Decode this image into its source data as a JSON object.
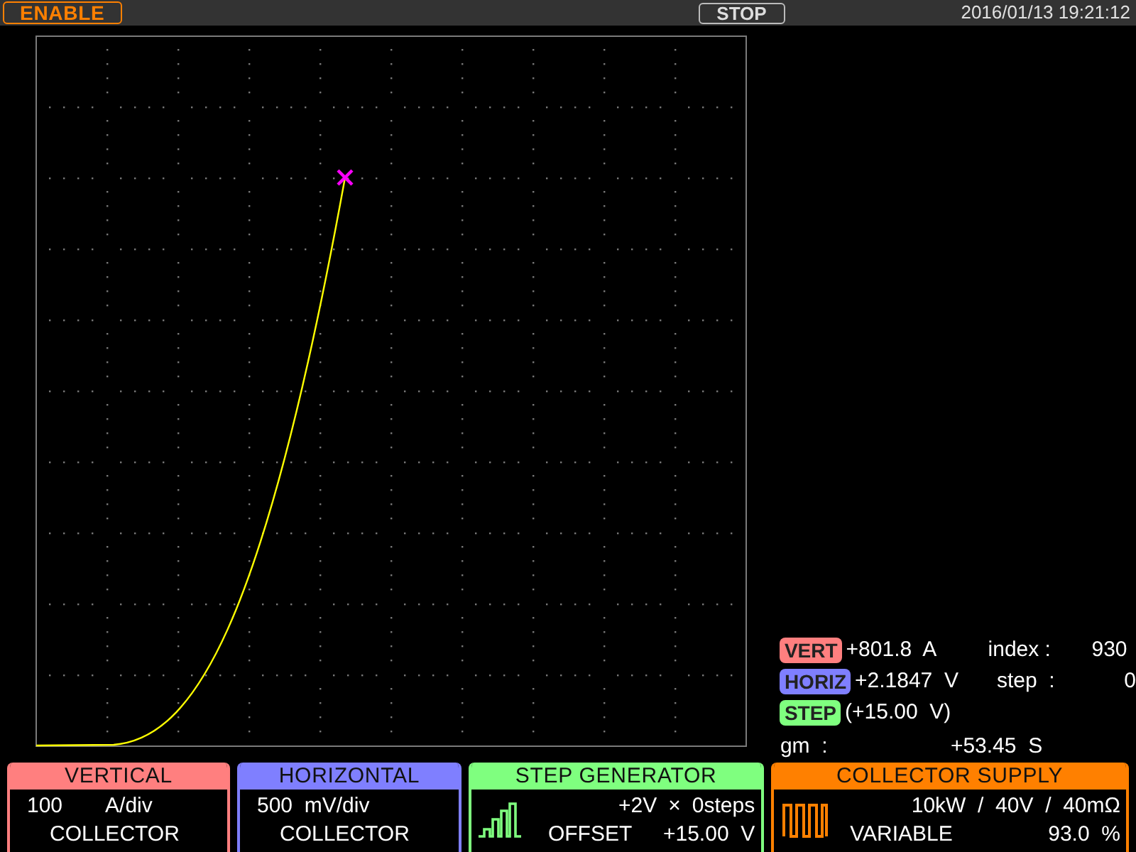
{
  "top_bar": {
    "mode_badge": "ENABLE",
    "run_state": "STOP",
    "datetime": "2016/01/13 19:21:12"
  },
  "readouts": [
    {
      "label": "VERT",
      "color": "#ff7f7f",
      "value": "+801.8  A",
      "extra_label": "index :",
      "extra_value": "930"
    },
    {
      "label": "HORIZ",
      "color": "#7f7fff",
      "value": "+2.1847  V",
      "extra_label": "step  :",
      "extra_value": "0"
    },
    {
      "label": "STEP",
      "color": "#7fff7f",
      "value": "(+15.00  V)"
    }
  ],
  "gm": {
    "label": "gm  :",
    "value": "+53.45  S"
  },
  "panels": [
    {
      "title": "VERTICAL",
      "color": "#ff7f7f",
      "kind": "plain",
      "rows": [
        [
          "100",
          "A/div"
        ],
        [
          "COLLECTOR"
        ]
      ]
    },
    {
      "title": "HORIZONTAL",
      "color": "#7f7fff",
      "kind": "plain",
      "rows": [
        [
          "500  mV/div"
        ],
        [
          "COLLECTOR"
        ]
      ]
    },
    {
      "title": "STEP GENERATOR",
      "color": "#7fff7f",
      "kind": "steps",
      "rows": [
        [
          "+2V",
          "×",
          "0steps"
        ],
        [
          "OFFSET",
          "+15.00  V"
        ]
      ]
    },
    {
      "title": "COLLECTOR SUPPLY",
      "color": "#ff8000",
      "kind": "pulse",
      "rows": [
        [
          "10kW  /  40V  /  40mΩ"
        ],
        [
          "VARIABLE",
          "93.0  %"
        ]
      ]
    }
  ]
}
